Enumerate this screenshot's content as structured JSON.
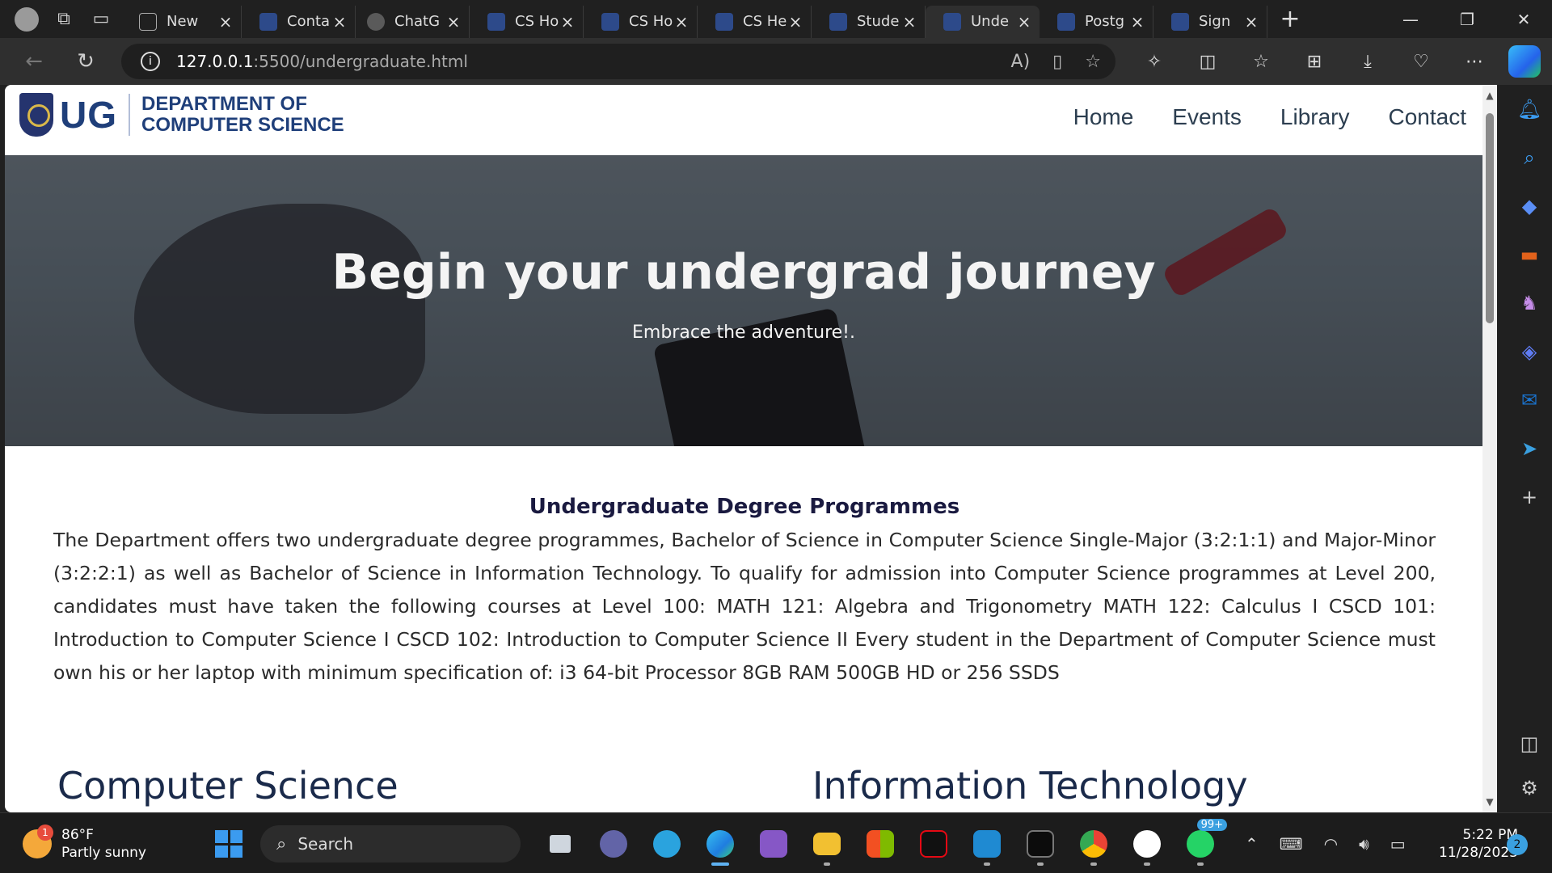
{
  "browser": {
    "tabs": [
      {
        "title": "New",
        "favicon": "page-icon",
        "active": false
      },
      {
        "title": "Conta",
        "favicon": "ug-crest-icon",
        "active": false
      },
      {
        "title": "ChatG",
        "favicon": "chatgpt-icon",
        "active": false
      },
      {
        "title": "CS Ho",
        "favicon": "ug-crest-icon",
        "active": false
      },
      {
        "title": "CS Ho",
        "favicon": "ug-crest-icon",
        "active": false
      },
      {
        "title": "CS He",
        "favicon": "ug-crest-icon",
        "active": false
      },
      {
        "title": "Stude",
        "favicon": "ug-crest-icon",
        "active": false
      },
      {
        "title": "Unde",
        "favicon": "ug-crest-icon",
        "active": true
      },
      {
        "title": "Postg",
        "favicon": "ug-crest-icon",
        "active": false
      },
      {
        "title": "Sign",
        "favicon": "ug-crest-icon",
        "active": false
      }
    ],
    "address": {
      "host": "127.0.0.1",
      "path": ":5500/undergraduate.html"
    }
  },
  "site": {
    "logo_text": "UG",
    "dept_line1": "DEPARTMENT OF",
    "dept_line2": "COMPUTER SCIENCE",
    "nav": [
      "Home",
      "Events",
      "Library",
      "Contact"
    ],
    "hero_title": "Begin your undergrad journey",
    "hero_subtitle": "Embrace the adventure!.",
    "section_title": "Undergraduate Degree Programmes",
    "section_text": "The Department offers two undergraduate degree programmes, Bachelor of Science in Computer Science Single-Major (3:2:1:1) and Major-Minor (3:2:2:1) as well as Bachelor of Science in Information Technology. To qualify for admission into Computer Science programmes at Level 200, candidates must have taken the following courses at Level 100: MATH 121: Algebra and Trigonometry MATH 122: Calculus I CSCD 101: Introduction to Computer Science I CSCD 102: Introduction to Computer Science II Every student in the Department of Computer Science must own his or her laptop with minimum specification of: i3 64-bit Processor 8GB RAM 500GB HD or 256 SSDS",
    "program1": "Computer Science",
    "program2": "Information Technology"
  },
  "taskbar": {
    "weather_temp": "86°F",
    "weather_desc": "Partly sunny",
    "weather_badge": "1",
    "search_label": "Search",
    "whatsapp_badge": "99+",
    "time": "5:22 PM",
    "date": "11/28/2023",
    "notification_count": "2"
  },
  "colors": {
    "brand_blue": "#1f3f7a",
    "accent": "#3b9bf0"
  }
}
